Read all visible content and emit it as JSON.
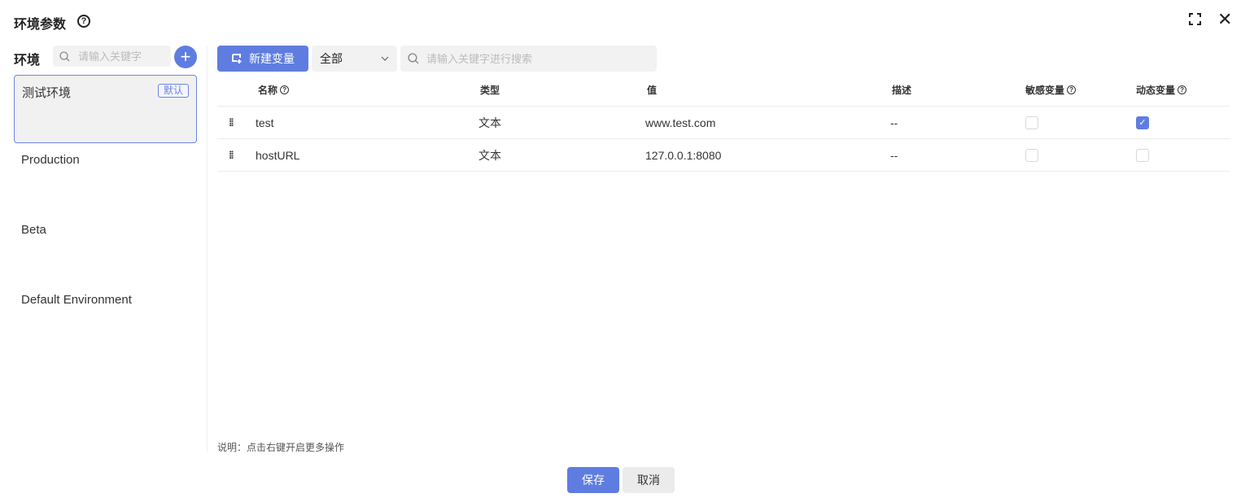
{
  "header": {
    "title": "环境参数"
  },
  "sidebar": {
    "label": "环境",
    "search_placeholder": "请输入关键字",
    "items": [
      {
        "name": "测试环境",
        "badge": "默认"
      },
      {
        "name": "Production"
      },
      {
        "name": "Beta"
      },
      {
        "name": "Default Environment"
      }
    ]
  },
  "toolbar": {
    "new_label": "新建变量",
    "filter_value": "全部",
    "search_placeholder": "请输入关键字进行搜索"
  },
  "table": {
    "columns": [
      "名称",
      "类型",
      "值",
      "描述",
      "敏感变量",
      "动态变量"
    ],
    "rows": [
      {
        "name": "test",
        "type": "文本",
        "value": "www.test.com",
        "desc": "--",
        "sensitive": false,
        "dynamic": true
      },
      {
        "name": "hostURL",
        "type": "文本",
        "value": "127.0.0.1:8080",
        "desc": "--",
        "sensitive": false,
        "dynamic": false
      }
    ]
  },
  "note": "说明：点击右键开启更多操作",
  "footer": {
    "save": "保存",
    "cancel": "取消"
  },
  "colors": {
    "accent": "#5f7de0"
  }
}
